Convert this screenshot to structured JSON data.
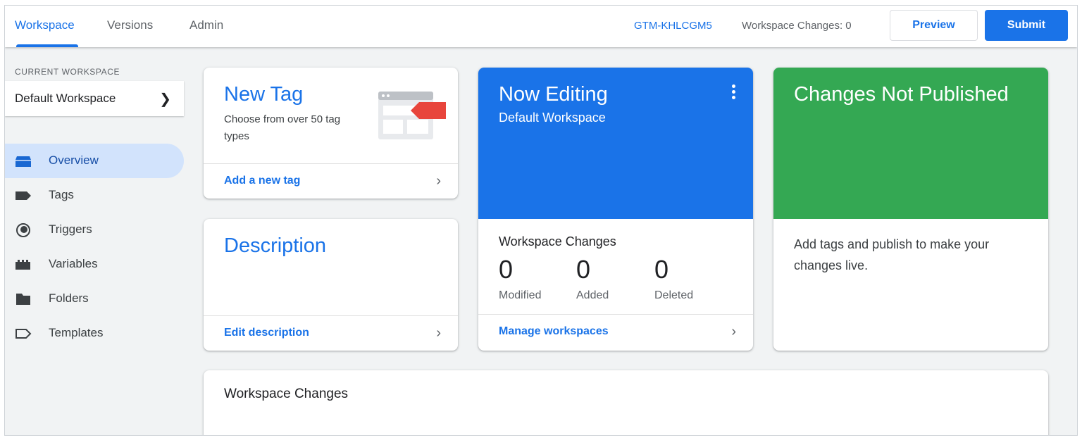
{
  "header": {
    "tabs": [
      {
        "label": "Workspace",
        "active": true
      },
      {
        "label": "Versions",
        "active": false
      },
      {
        "label": "Admin",
        "active": false
      }
    ],
    "container_id": "GTM-KHLCGM5",
    "workspace_changes": "Workspace Changes: 0",
    "preview_label": "Preview",
    "submit_label": "Submit"
  },
  "sidebar": {
    "current_workspace_label": "CURRENT WORKSPACE",
    "workspace_name": "Default Workspace",
    "items": [
      {
        "label": "Overview",
        "icon": "overview-icon",
        "active": true
      },
      {
        "label": "Tags",
        "icon": "tag-icon",
        "active": false
      },
      {
        "label": "Triggers",
        "icon": "trigger-icon",
        "active": false
      },
      {
        "label": "Variables",
        "icon": "variables-icon",
        "active": false
      },
      {
        "label": "Folders",
        "icon": "folder-icon",
        "active": false
      },
      {
        "label": "Templates",
        "icon": "template-icon",
        "active": false
      }
    ]
  },
  "cards": {
    "new_tag": {
      "title": "New Tag",
      "subtitle": "Choose from over 50 tag types",
      "link": "Add a new tag"
    },
    "description": {
      "title": "Description",
      "link": "Edit description"
    },
    "now_editing": {
      "title": "Now Editing",
      "subtitle": "Default Workspace",
      "changes_label": "Workspace Changes",
      "stats": [
        {
          "value": "0",
          "label": "Modified"
        },
        {
          "value": "0",
          "label": "Added"
        },
        {
          "value": "0",
          "label": "Deleted"
        }
      ],
      "link": "Manage workspaces"
    },
    "changes_not_published": {
      "title": "Changes Not Published",
      "body": "Add tags and publish to make your changes live."
    },
    "workspace_changes": {
      "title": "Workspace Changes"
    }
  },
  "colors": {
    "accent_blue": "#1a73e8",
    "published_green": "#34a853",
    "active_nav_bg": "#d2e3fc",
    "tag_red": "#e8453c"
  }
}
